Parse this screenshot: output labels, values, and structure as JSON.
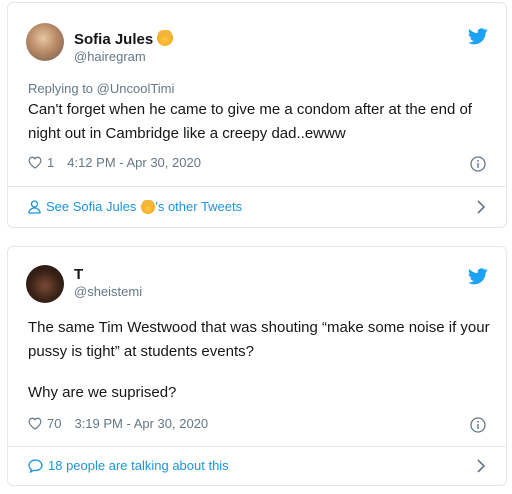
{
  "tweets": [
    {
      "author_name": "Sofia Jules",
      "author_emoji": "person-with-blond-hair-emoji",
      "handle": "@hairegram",
      "replying_prefix": "Replying to",
      "replying_to": "@UncoolTimi",
      "text": "Can't forget when he came to give me a condom after at the end of night out in Cambridge like a creepy dad..ewww",
      "like_count": "1",
      "timestamp": "4:12 PM - Apr 30, 2020",
      "footer_prefix": "See Sofia Jules",
      "footer_suffix": "'s other Tweets"
    },
    {
      "author_name": "T",
      "handle": "@sheistemi",
      "text_line1": "The same Tim Westwood that was shouting “make some noise if your pussy is tight” at students events?",
      "text_line2": "Why are we suprised?",
      "like_count": "70",
      "timestamp": "3:19 PM - Apr 30, 2020",
      "footer": "18 people are talking about this"
    }
  ],
  "colors": {
    "link": "#1b95e0",
    "twitter_blue": "#1da1f2",
    "secondary_text": "#657786",
    "border": "#e1e8ed"
  },
  "icons": [
    "twitter-bird-icon",
    "heart-icon",
    "info-icon",
    "person-icon",
    "speech-bubble-icon",
    "chevron-right-icon"
  ]
}
